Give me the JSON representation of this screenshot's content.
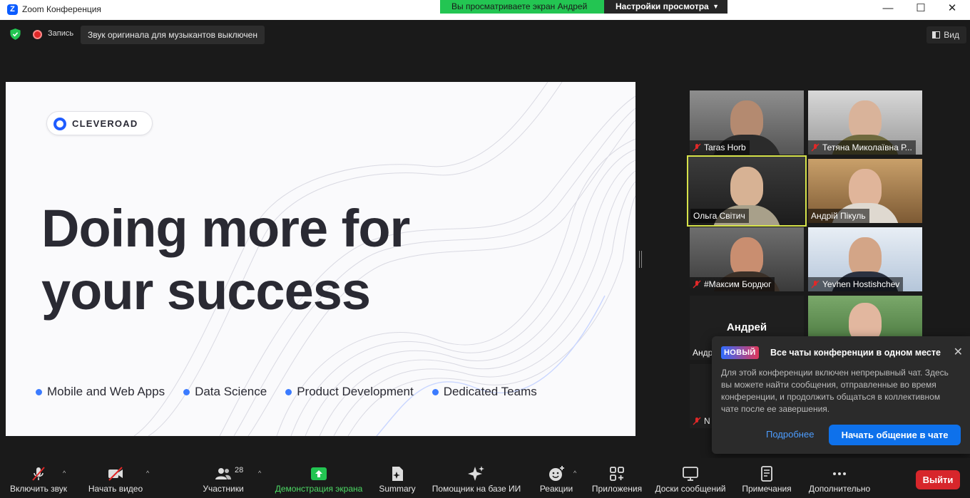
{
  "window": {
    "title": "Zoom Конференция",
    "logo_letter": "Z",
    "minimize": "—",
    "maximize": "☐",
    "close": "✕"
  },
  "share_banner": {
    "viewing_text": "Вы просматриваете экран Андрей",
    "view_options": "Настройки просмотра"
  },
  "top_bar": {
    "recording_label": "Запись",
    "original_sound": "Звук оригинала для музыкантов выключен",
    "view_label": "Вид"
  },
  "slide": {
    "brand": "CLEVEROAD",
    "headline_line1": "Doing more for",
    "headline_line2": "your success",
    "services": [
      "Mobile and Web Apps",
      "Data Science",
      "Product Development",
      "Dedicated Teams"
    ]
  },
  "participants": [
    {
      "name": "Taras Horb",
      "muted": true,
      "active": false
    },
    {
      "name": "Тетяна Миколаївна Р...",
      "muted": true,
      "active": false
    },
    {
      "name": "Ольга Світич",
      "muted": false,
      "active": true
    },
    {
      "name": "Андрій Пікуль",
      "muted": false,
      "active": false
    },
    {
      "name": "#Максим Бордюг",
      "muted": true,
      "active": false
    },
    {
      "name": "Yevhen Hostishchev",
      "muted": true,
      "active": false
    },
    {
      "name": "Андр",
      "display_name": "Андрей",
      "muted": false,
      "active": false
    },
    {
      "name": "",
      "muted": false,
      "active": false
    },
    {
      "name": "N",
      "muted": true,
      "active": false
    }
  ],
  "chat_popup": {
    "badge": "НОВЫЙ",
    "title": "Все чаты конференции в одном месте",
    "body": "Для этой конференции включен непрерывный чат. Здесь вы можете найти сообщения, отправленные во время конференции, и продолжить общаться в коллективном чате после ее завершения.",
    "more_link": "Подробнее",
    "start_button": "Начать общение в чате",
    "close": "✕"
  },
  "toolbar": {
    "unmute": "Включить звук",
    "start_video": "Начать видео",
    "participants": "Участники",
    "participants_count": "28",
    "share_screen": "Демонстрация экрана",
    "summary": "Summary",
    "ai_companion": "Помощник на базе ИИ",
    "reactions": "Реакции",
    "apps": "Приложения",
    "whiteboards": "Доски сообщений",
    "notes": "Примечания",
    "more": "Дополнительно",
    "leave": "Выйти"
  },
  "colors": {
    "accent_green": "#23c552",
    "brand_blue": "#0b5cff",
    "leave_red": "#d7262b",
    "active_speaker": "#d7e34a",
    "service_dot": "#3b7bff"
  }
}
